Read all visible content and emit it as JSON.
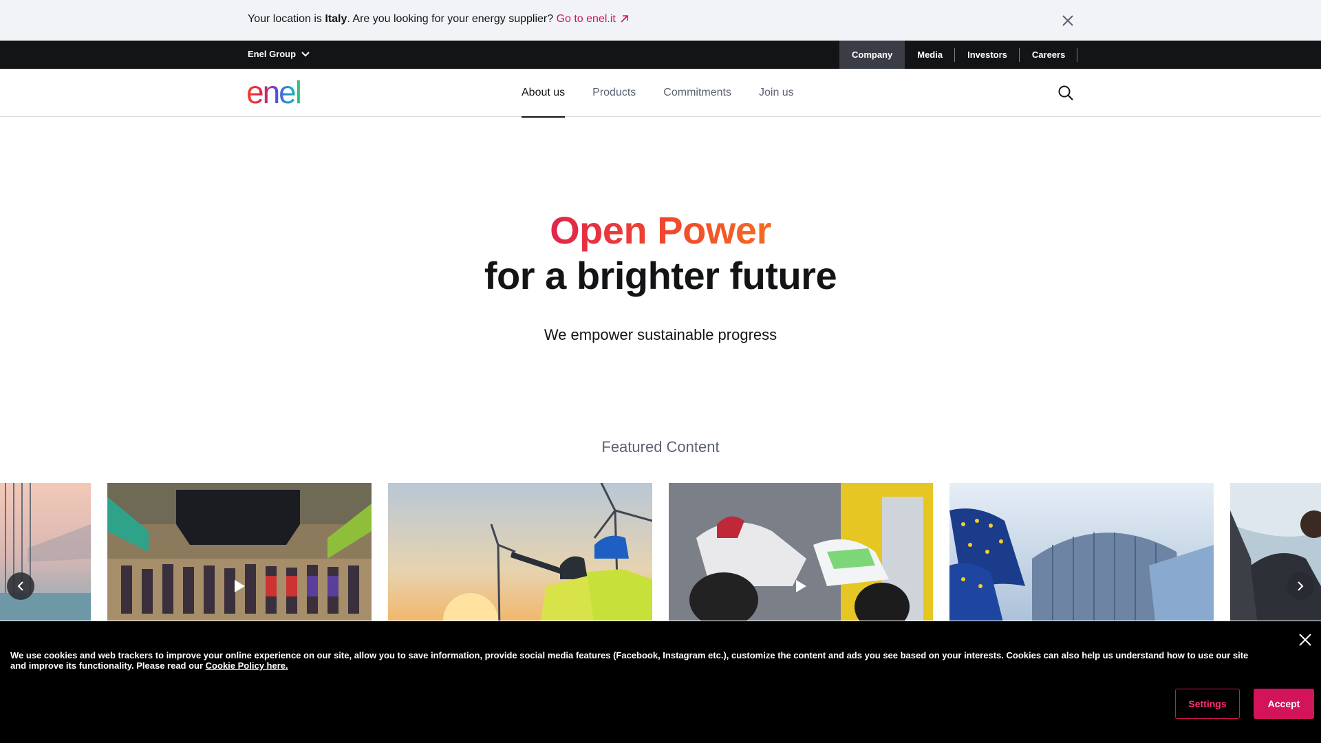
{
  "location_banner": {
    "prefix": "Your location is ",
    "country": "Italy",
    "suffix": ". Are you looking for your energy supplier? ",
    "link_label": "Go to enel.it"
  },
  "top_nav": {
    "group_label": "Enel Group",
    "links": [
      "Company",
      "Media",
      "Investors",
      "Careers"
    ],
    "active": "Company"
  },
  "header": {
    "logo_text": "enel",
    "nav": [
      "About us",
      "Products",
      "Commitments",
      "Join us"
    ],
    "active_nav": "About us"
  },
  "hero": {
    "line1": "Open Power",
    "line2": "for a brighter future",
    "subtitle": "We empower sustainable progress"
  },
  "featured": {
    "title": "Featured Content",
    "cards": [
      {
        "image": "bridge-sunset-photo",
        "video": false
      },
      {
        "image": "race-finish-line-photo",
        "video": true
      },
      {
        "image": "wind-turbine-workers-photo",
        "video": false
      },
      {
        "image": "electric-motorbike-photo",
        "video": true
      },
      {
        "image": "eu-flags-parliament-photo",
        "video": false
      },
      {
        "image": "person-outdoors-photo",
        "video": false
      }
    ]
  },
  "cookie_banner": {
    "text": "We use cookies and web trackers to improve your online experience on our site, allow you to save information, provide social media features (Facebook, Instagram etc.), customize the content and ads you see based on your interests. Cookies can also help us understand how to use our site and improve its functionality. Please read our ",
    "link_label": "Cookie Policy here.",
    "settings_label": "Settings",
    "accept_label": "Accept"
  },
  "colors": {
    "brand_pink": "#d3135a",
    "dark": "#131416",
    "banner_bg": "#f1f3f7"
  }
}
